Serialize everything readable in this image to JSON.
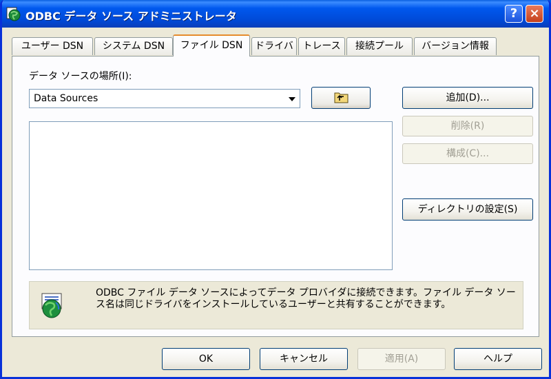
{
  "window": {
    "title": "ODBC データ ソース アドミニストレータ",
    "help_glyph": "?",
    "close_glyph": "×"
  },
  "tabs": [
    {
      "label": "ユーザー DSN"
    },
    {
      "label": "システム DSN"
    },
    {
      "label": "ファイル DSN"
    },
    {
      "label": "ドライバ"
    },
    {
      "label": "トレース"
    },
    {
      "label": "接続プール"
    },
    {
      "label": "バージョン情報"
    }
  ],
  "panel": {
    "location_label": "データ ソースの場所(I):",
    "location_value": "Data Sources",
    "buttons": {
      "add": "追加(D)...",
      "remove": "削除(R)",
      "configure": "構成(C)...",
      "set_directory": "ディレクトリの設定(S)"
    },
    "info_text": "ODBC ファイル データ ソースによってデータ プロバイダに接続できます。ファイル データ ソース名は同じドライバをインストールしているユーザーと共有することができます。"
  },
  "footer": {
    "ok": "OK",
    "cancel": "キャンセル",
    "apply": "適用(A)",
    "help": "ヘルプ"
  },
  "colors": {
    "title_bar": "#0058ee",
    "tab_active_accent": "#e68b2c",
    "face": "#ece9d8"
  }
}
